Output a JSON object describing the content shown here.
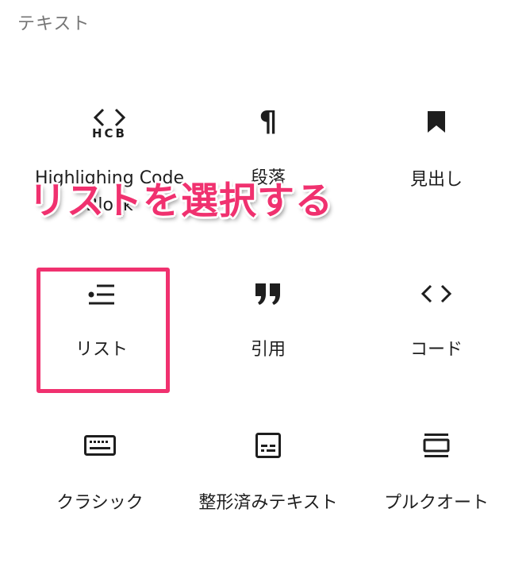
{
  "section": {
    "title": "テキスト"
  },
  "blocks": [
    {
      "label": "Highlighing Code Block",
      "icon": "hcb-code-icon",
      "icon_text": "HCB"
    },
    {
      "label": "段落",
      "icon": "pilcrow-icon",
      "icon_text": "¶"
    },
    {
      "label": "見出し",
      "icon": "bookmark-icon"
    },
    {
      "label": "リスト",
      "icon": "list-icon"
    },
    {
      "label": "引用",
      "icon": "quote-icon"
    },
    {
      "label": "コード",
      "icon": "code-icon"
    },
    {
      "label": "クラシック",
      "icon": "keyboard-icon"
    },
    {
      "label": "整形済みテキスト",
      "icon": "preformatted-icon"
    },
    {
      "label": "プルクオート",
      "icon": "pullquote-icon"
    }
  ],
  "annotation": {
    "text": "リストを選択する",
    "color": "#f0316f"
  },
  "colors": {
    "highlight": "#f0316f",
    "section_title": "#757575",
    "text": "#1e1e1e"
  }
}
